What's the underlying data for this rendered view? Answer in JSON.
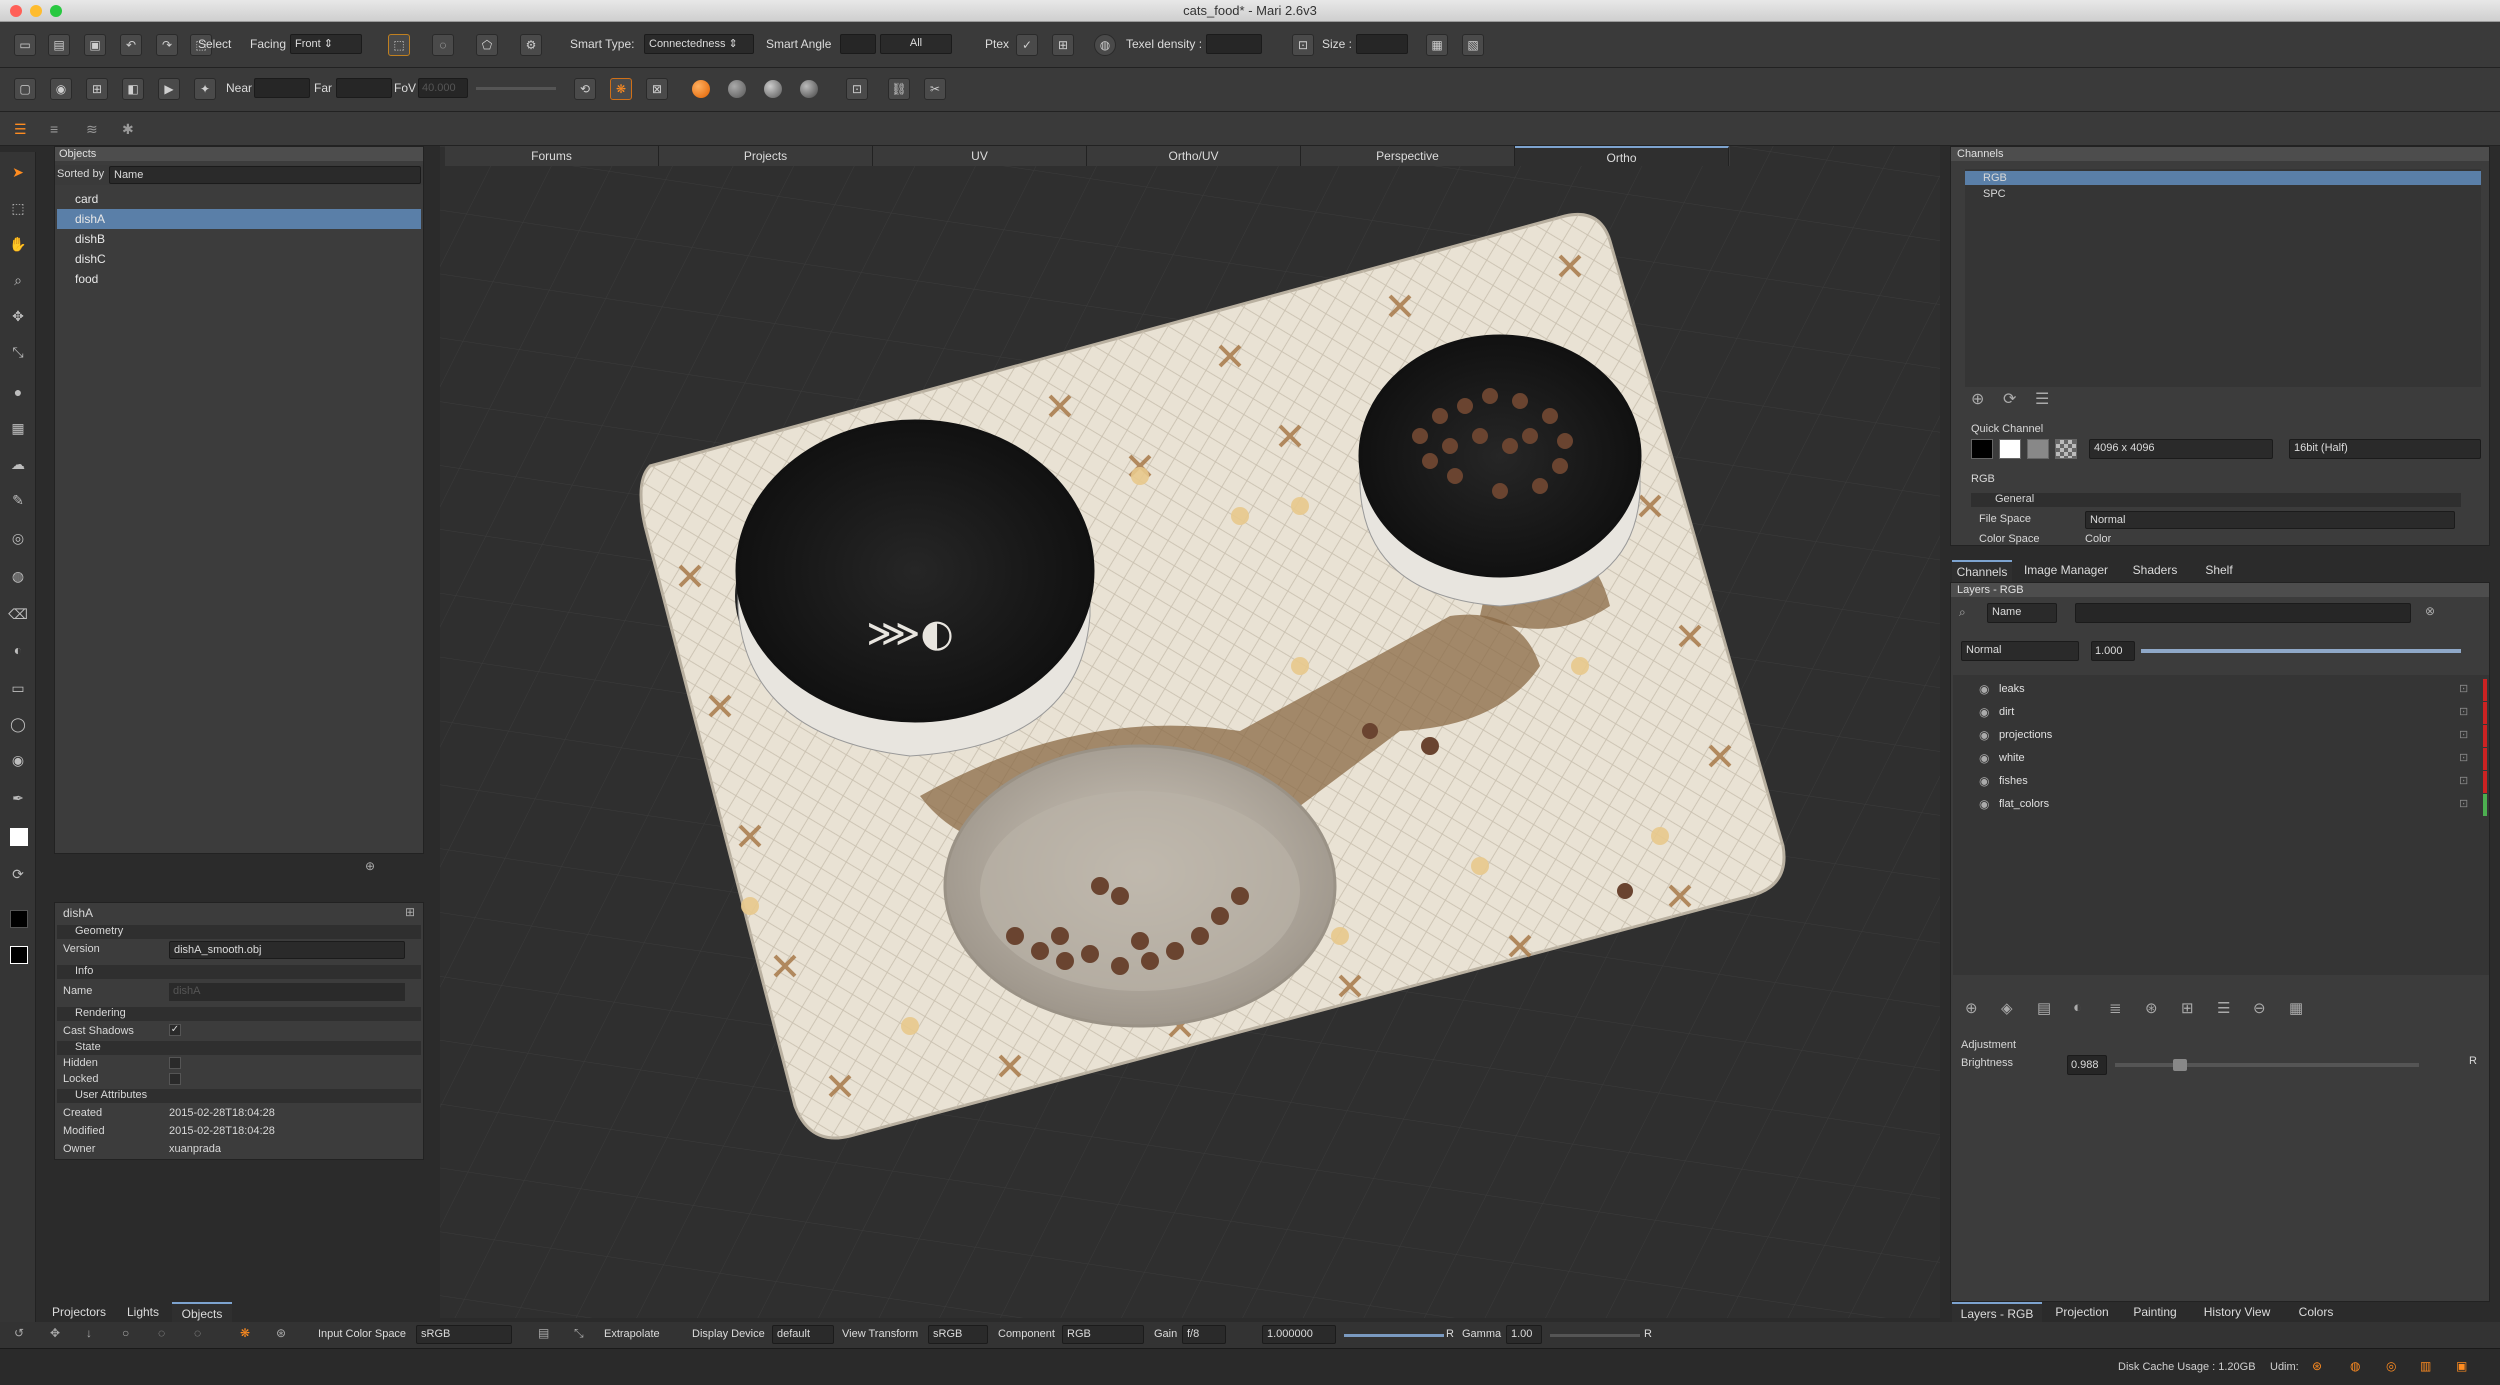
{
  "window": {
    "title": "cats_food* - Mari 2.6v3"
  },
  "toolbar1": {
    "select_label": "Select",
    "facing_label": "Facing",
    "facing_value": "Front",
    "smart_type_label": "Smart Type:",
    "smart_type_value": "Connectedness",
    "smart_angle_label": "Smart Angle",
    "all_value": "All",
    "ptex_label": "Ptex",
    "texel_density_label": "Texel density :",
    "size_label": "Size :"
  },
  "toolbar2": {
    "near_label": "Near",
    "far_label": "Far",
    "fov_label": "FoV",
    "fov_value": "40.000"
  },
  "objects_panel": {
    "title": "Objects",
    "sorted_by_label": "Sorted by",
    "sorted_by_value": "Name",
    "items": [
      {
        "label": "card",
        "selected": false
      },
      {
        "label": "dishA",
        "selected": true
      },
      {
        "label": "dishB",
        "selected": false
      },
      {
        "label": "dishC",
        "selected": false
      },
      {
        "label": "food",
        "selected": false
      }
    ]
  },
  "properties_panel": {
    "title": "dishA",
    "geometry_header": "Geometry",
    "version_label": "Version",
    "version_value": "dishA_smooth.obj",
    "info_header": "Info",
    "name_label": "Name",
    "name_value": "dishA",
    "rendering_header": "Rendering",
    "cast_shadows_label": "Cast Shadows",
    "cast_shadows_check": "✓",
    "state_header": "State",
    "hidden_label": "Hidden",
    "locked_label": "Locked",
    "user_attributes_header": "User Attributes",
    "created_label": "Created",
    "created_value": "2015-02-28T18:04:28",
    "modified_label": "Modified",
    "modified_value": "2015-02-28T18:04:28",
    "owner_label": "Owner",
    "owner_value": "xuanprada"
  },
  "left_bottom_tabs": [
    "Projectors",
    "Lights",
    "Objects"
  ],
  "viewport_tabs": [
    {
      "label": "Forums",
      "active": false
    },
    {
      "label": "Projects",
      "active": false
    },
    {
      "label": "UV",
      "active": false
    },
    {
      "label": "Ortho/UV",
      "active": false
    },
    {
      "label": "Perspective",
      "active": false
    },
    {
      "label": "Ortho",
      "active": true
    }
  ],
  "channels_panel": {
    "title": "Channels",
    "items": [
      {
        "label": "RGB",
        "selected": true
      },
      {
        "label": "SPC",
        "selected": false
      }
    ],
    "quick_channel_label": "Quick Channel",
    "resolution_value": "4096 x 4096",
    "depth_value": "16bit (Half)",
    "rgb_label": "RGB",
    "general_header": "General",
    "file_space_label": "File Space",
    "file_space_value": "Normal",
    "color_space_label": "Color Space",
    "color_space_value": "Color"
  },
  "right_mid_tabs": [
    "Channels",
    "Image Manager",
    "Shaders",
    "Shelf"
  ],
  "layers_panel": {
    "title": "Layers - RGB",
    "filter_label": "Name",
    "blend_mode": "Normal",
    "opacity_value": "1.000",
    "opacity_fraction": 1.0,
    "items": [
      {
        "label": "leaks",
        "color": "#cc2222"
      },
      {
        "label": "dirt",
        "color": "#cc2222"
      },
      {
        "label": "projections",
        "color": "#cc2222"
      },
      {
        "label": "white",
        "color": "#cc2222"
      },
      {
        "label": "fishes",
        "color": "#cc2222"
      },
      {
        "label": "flat_colors",
        "color": "#4caf50"
      }
    ],
    "adjustment_header": "Adjustment",
    "brightness_label": "Brightness",
    "brightness_value": "0.988",
    "brightness_fraction": 0.2,
    "reset_label": "R"
  },
  "right_bottom_tabs": [
    "Layers - RGB",
    "Projection",
    "Painting",
    "History View",
    "Colors"
  ],
  "bottom_toolbar": {
    "input_color_space_label": "Input Color Space",
    "input_color_space_value": "sRGB",
    "extrapolate_label": "Extrapolate",
    "display_device_label": "Display Device",
    "display_device_value": "default",
    "view_transform_label": "View Transform",
    "view_transform_value": "sRGB",
    "component_label": "Component",
    "component_value": "RGB",
    "gain_label": "Gain",
    "gain_value": "f/8",
    "gain_num": "1.000000",
    "gain_r": "R",
    "gamma_label": "Gamma",
    "gamma_value": "1.00",
    "gamma_r": "R"
  },
  "status": {
    "disk_cache": "Disk Cache Usage : 1.20GB",
    "udim_label": "Udim:"
  },
  "colors": {
    "accent": "#5a7fa8",
    "mat": "#e8e0d2",
    "bowl_dark": "#1b1b1b",
    "fish_brown": "#7b5a3a",
    "kibble": "#5b3a26"
  }
}
